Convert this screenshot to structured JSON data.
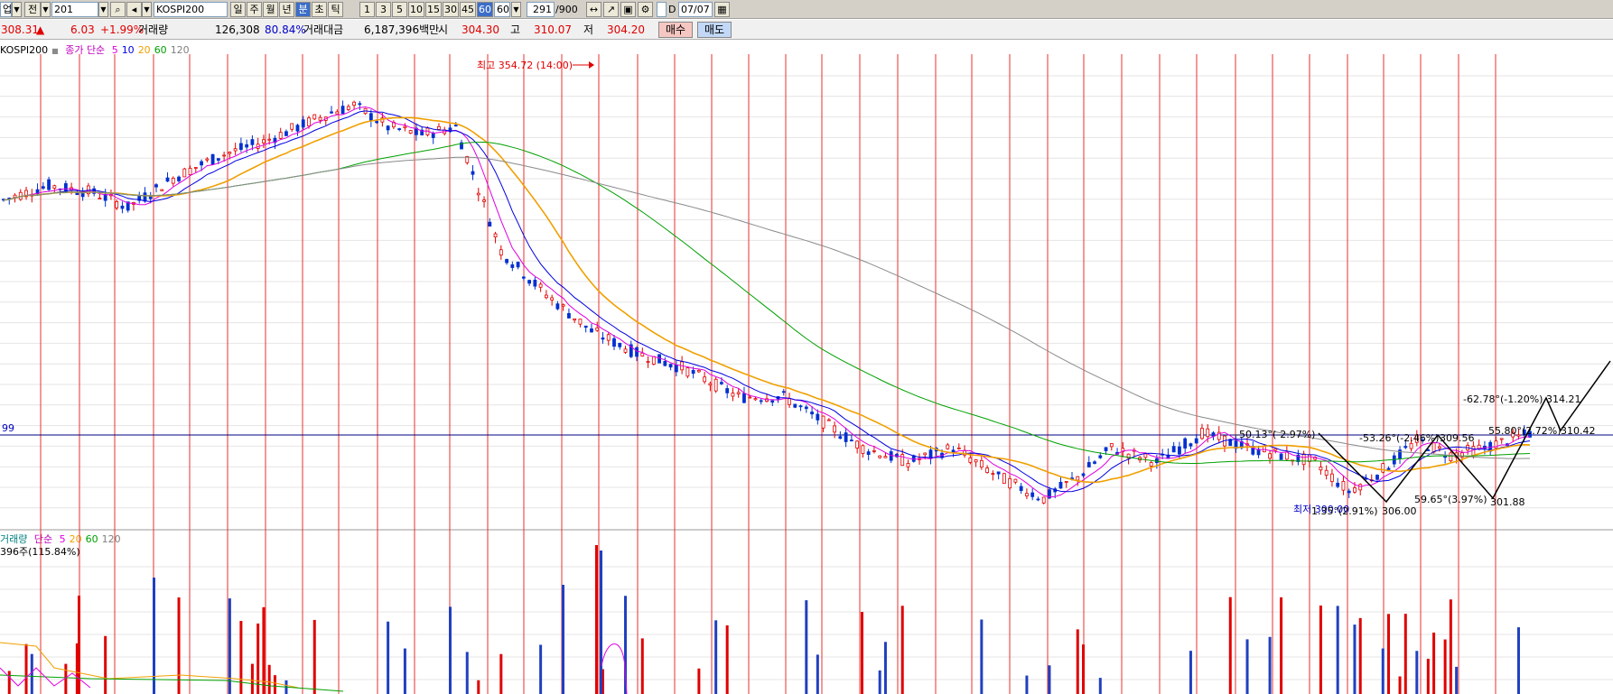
{
  "toolbar": {
    "mode_select": "업",
    "prev_btn": "전",
    "code_value": "201",
    "name_value": "KOSPI200",
    "period_tabs": [
      {
        "label": "일",
        "active": false
      },
      {
        "label": "주",
        "active": false
      },
      {
        "label": "월",
        "active": false
      },
      {
        "label": "년",
        "active": false
      },
      {
        "label": "분",
        "active": true
      },
      {
        "label": "초",
        "active": false
      },
      {
        "label": "틱",
        "active": false
      }
    ],
    "interval_tabs": [
      {
        "label": "1",
        "active": false
      },
      {
        "label": "3",
        "active": false
      },
      {
        "label": "5",
        "active": false
      },
      {
        "label": "10",
        "active": false
      },
      {
        "label": "15",
        "active": false
      },
      {
        "label": "30",
        "active": false
      },
      {
        "label": "45",
        "active": false
      },
      {
        "label": "60",
        "active": true
      }
    ],
    "interval_select": "60",
    "count": "291",
    "count_total": "/900",
    "date_label": "D",
    "date_value": "07/07"
  },
  "quote": {
    "price": "308.31",
    "direction": "▲",
    "change": "6.03",
    "change_pct": "+1.99%",
    "volume_label": "거래량",
    "volume": "126,308",
    "volume_ratio": "80.84%",
    "amount_label": "거래대금",
    "amount": "6,187,396백만",
    "open_label": "시",
    "open": "304.30",
    "high_label": "고",
    "high": "310.07",
    "low_label": "저",
    "low": "304.20",
    "buy_label": "매수",
    "sell_label": "매도"
  },
  "price_legend": {
    "symbol": "KOSPI200",
    "desc": "종가 단순",
    "periods": [
      {
        "label": "5",
        "color": "#e000e0"
      },
      {
        "label": "10",
        "color": "#0000e0"
      },
      {
        "label": "20",
        "color": "#f0a000"
      },
      {
        "label": "60",
        "color": "#00a000"
      },
      {
        "label": "120",
        "color": "#808080"
      }
    ]
  },
  "volume_legend": {
    "symbol": "거래량",
    "desc": "단순",
    "periods": [
      {
        "label": "5",
        "color": "#e000e0"
      },
      {
        "label": "20",
        "color": "#f0a000"
      },
      {
        "label": "60",
        "color": "#00a000"
      },
      {
        "label": "120",
        "color": "#808080"
      }
    ],
    "current": "396주(115.84%)"
  },
  "chart_data": {
    "type": "candlestick",
    "y_range": [
      295,
      360
    ],
    "reference_line_label": "99",
    "annotations": {
      "max_label": "최고 354.72 (14:00)",
      "min_label": "최저 300.00",
      "wave_labels": [
        "-50.13°(-2.97%)",
        "-53.26°(-2.46%)",
        "309.56",
        "55.80°(2.72%)",
        "310.42",
        "-62.78°(-1.20%)",
        "314.21",
        "59.65°(3.97%)",
        "301.88",
        "1.35°(2.91%)",
        "306.00"
      ]
    },
    "price_path": [
      [
        0,
        340
      ],
      [
        8,
        342
      ],
      [
        16,
        341
      ],
      [
        22,
        339
      ],
      [
        30,
        343
      ],
      [
        38,
        346
      ],
      [
        46,
        348
      ],
      [
        52,
        350
      ],
      [
        58,
        352
      ],
      [
        62,
        353
      ],
      [
        68,
        350
      ],
      [
        74,
        349
      ],
      [
        80,
        350
      ],
      [
        88,
        333
      ],
      [
        96,
        327
      ],
      [
        104,
        322
      ],
      [
        112,
        319
      ],
      [
        120,
        317
      ],
      [
        130,
        313
      ],
      [
        138,
        313
      ],
      [
        144,
        310
      ],
      [
        152,
        306
      ],
      [
        160,
        304
      ],
      [
        168,
        306
      ],
      [
        176,
        302
      ],
      [
        184,
        299
      ],
      [
        190,
        302
      ],
      [
        196,
        306
      ],
      [
        204,
        304
      ],
      [
        212,
        308
      ],
      [
        220,
        306
      ],
      [
        226,
        305
      ],
      [
        232,
        304
      ],
      [
        238,
        300
      ],
      [
        244,
        303
      ],
      [
        250,
        307
      ],
      [
        256,
        305
      ],
      [
        262,
        306
      ],
      [
        270,
        308
      ]
    ]
  }
}
